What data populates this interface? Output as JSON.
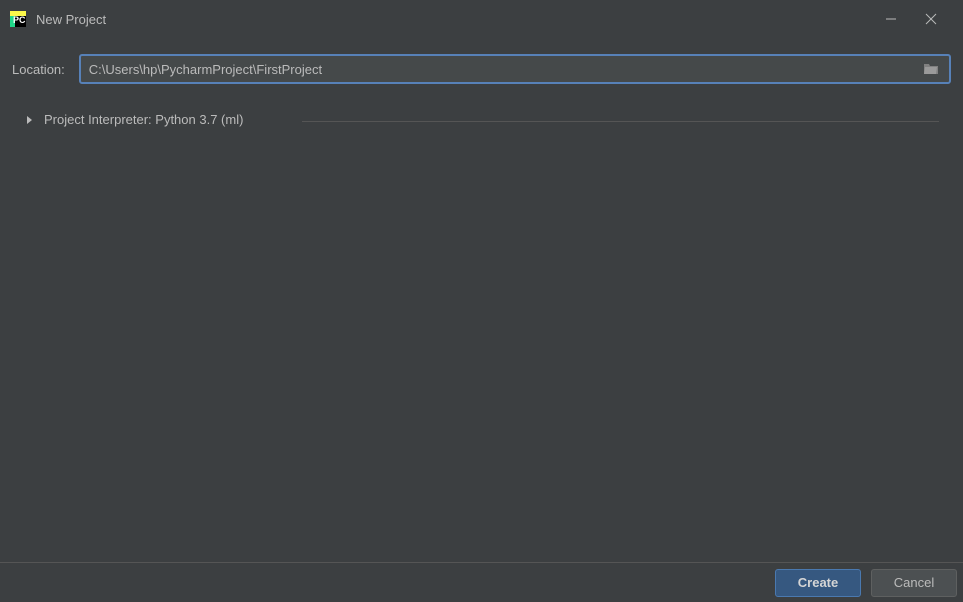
{
  "window": {
    "title": "New Project"
  },
  "form": {
    "location_label": "Location:",
    "location_value": "C:\\Users\\hp\\PycharmProject\\FirstProject",
    "interpreter_label": "Project Interpreter: Python 3.7 (ml)"
  },
  "buttons": {
    "create": "Create",
    "cancel": "Cancel"
  }
}
